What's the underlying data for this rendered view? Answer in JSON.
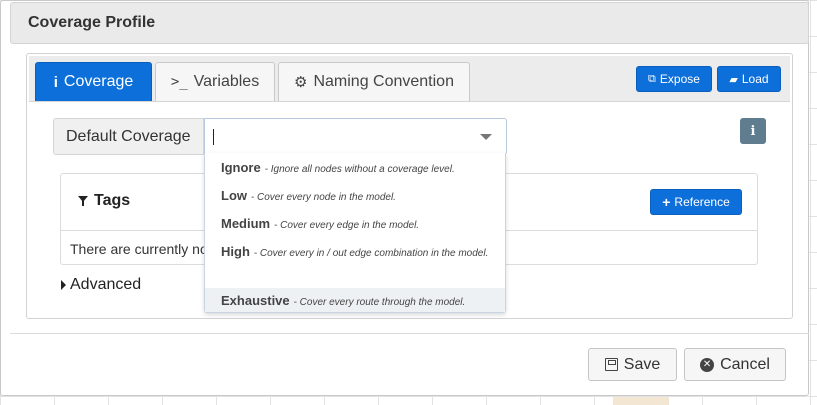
{
  "dialog": {
    "title": "Coverage Profile"
  },
  "tabs": [
    {
      "label": "Coverage",
      "icon": "info-icon",
      "active": true
    },
    {
      "label": "Variables",
      "icon": "terminal-icon",
      "icon_text": ">_",
      "active": false
    },
    {
      "label": "Naming Convention",
      "icon": "gear-icon",
      "active": false
    }
  ],
  "toolbar": {
    "expose_label": "Expose",
    "expose_icon": "external-link-icon",
    "load_label": "Load",
    "load_icon": "folder-open-icon"
  },
  "coverage_field": {
    "label": "Default Coverage",
    "value": ""
  },
  "coverage_options": [
    {
      "name": "Ignore",
      "desc": "Ignore all nodes without a coverage level."
    },
    {
      "name": "Low",
      "desc": "Cover every node in the model."
    },
    {
      "name": "Medium",
      "desc": "Cover every edge in the model."
    },
    {
      "name": "High",
      "desc": "Cover every in / out edge combination in the model."
    },
    {
      "name": "Exhaustive",
      "desc": "Cover every route through the model.",
      "highlighted": true
    }
  ],
  "tags": {
    "title": "Tags",
    "reference_label": "Reference",
    "empty_text": "There are currently no"
  },
  "advanced": {
    "label": "Advanced"
  },
  "footer": {
    "save_label": "Save",
    "cancel_label": "Cancel"
  },
  "colors": {
    "primary": "#0d6fd9",
    "info_button": "#5f7d8f",
    "header_bg": "#eaeaea"
  }
}
